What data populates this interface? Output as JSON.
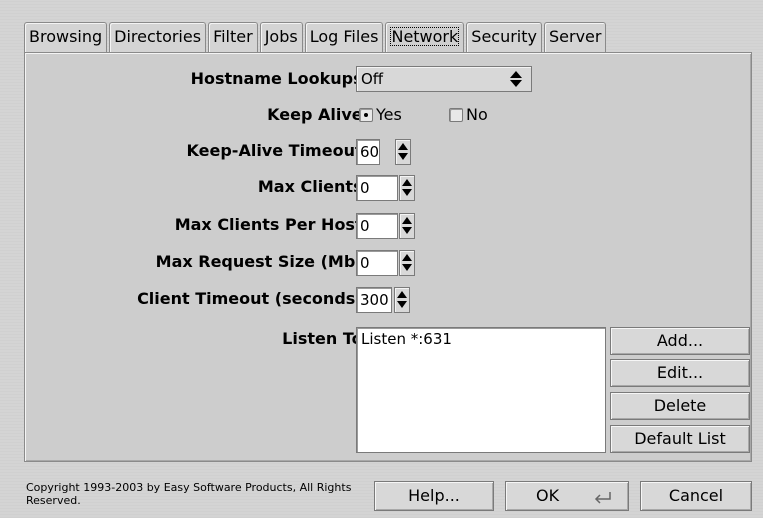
{
  "tabs": [
    {
      "label": "Browsing",
      "active": false
    },
    {
      "label": "Directories",
      "active": false
    },
    {
      "label": "Filter",
      "active": false
    },
    {
      "label": "Jobs",
      "active": false
    },
    {
      "label": "Log Files",
      "active": false
    },
    {
      "label": "Network",
      "active": true
    },
    {
      "label": "Security",
      "active": false
    },
    {
      "label": "Server",
      "active": false
    }
  ],
  "form": {
    "hostname_lookups": {
      "label": "Hostname Lookups:",
      "value": "Off"
    },
    "keep_alive": {
      "label": "Keep Alive:",
      "yes": "Yes",
      "no": "No",
      "selected": "Yes"
    },
    "keep_alive_timeout": {
      "label": "Keep-Alive Timeout:",
      "value": "60"
    },
    "max_clients": {
      "label": "Max Clients:",
      "value": "0"
    },
    "max_clients_per_host": {
      "label": "Max Clients Per Host:",
      "value": "0"
    },
    "max_request_size": {
      "label": "Max Request Size (Mb):",
      "value": "0"
    },
    "client_timeout": {
      "label": "Client Timeout (seconds):",
      "value": "300"
    },
    "listen_to": {
      "label": "Listen To:",
      "items": [
        "Listen *:631"
      ]
    }
  },
  "listen_buttons": {
    "add": "Add...",
    "edit": "Edit...",
    "delete": "Delete",
    "default_list": "Default List"
  },
  "footer": {
    "copyright": "Copyright 1993-2003 by Easy Software Products, All Rights Reserved.",
    "help": "Help...",
    "ok": "OK",
    "cancel": "Cancel"
  }
}
